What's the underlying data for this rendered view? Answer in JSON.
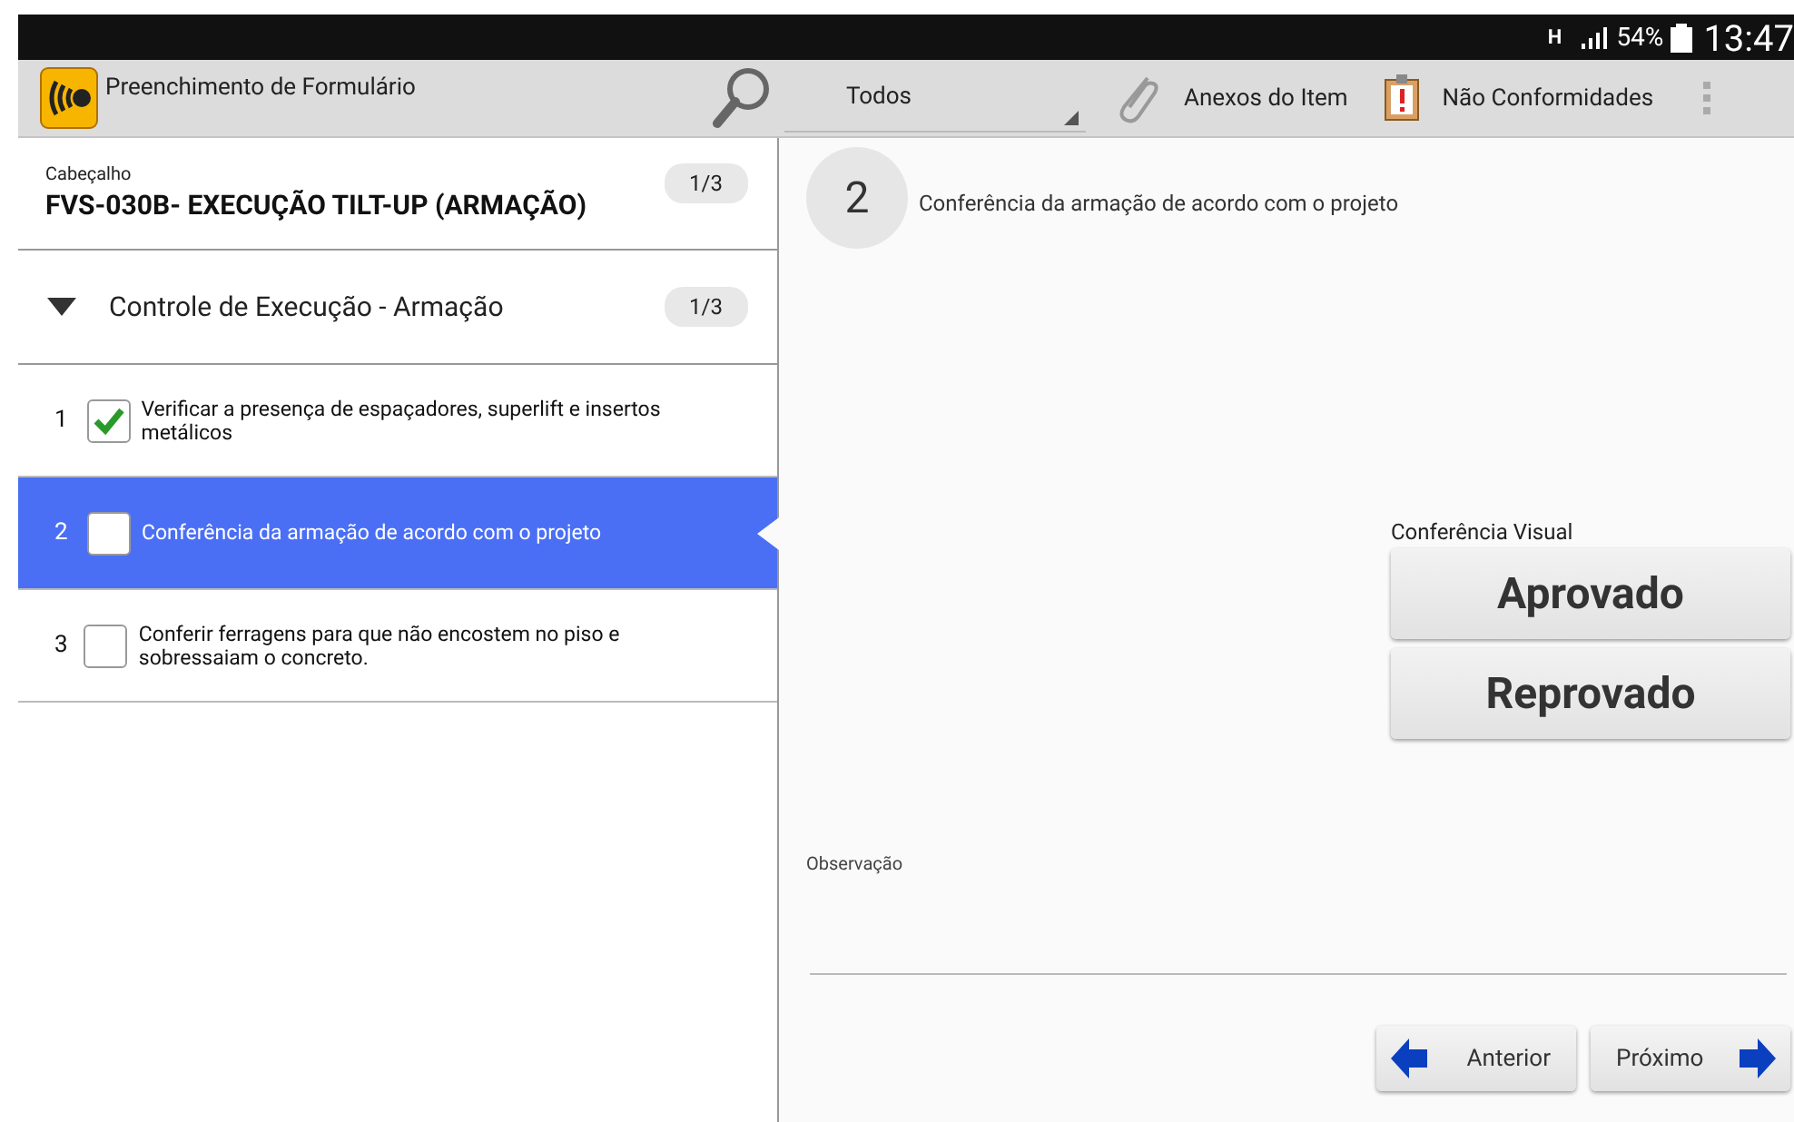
{
  "status_bar": {
    "network": "H",
    "battery": "54%",
    "time": "13:47"
  },
  "action_bar": {
    "title": "Preenchimento de Formulário",
    "filter": "Todos",
    "attachments": "Anexos do Item",
    "nonconformities": "Não Conformidades"
  },
  "header": {
    "label": "Cabeçalho",
    "title": "FVS-030B- EXECUÇÃO TILT-UP (ARMAÇÃO)",
    "count": "1/3"
  },
  "group": {
    "title": "Controle de Execução - Armação",
    "count": "1/3",
    "expanded": true
  },
  "items": [
    {
      "number": "1",
      "text": "Verificar a presença de espaçadores, superlift e insertos metálicos",
      "checked": true,
      "selected": false
    },
    {
      "number": "2",
      "text": "Conferência da armação de acordo com o projeto",
      "checked": false,
      "selected": true
    },
    {
      "number": "3",
      "text": "Conferir ferragens para que não encostem no piso e sobressaiam o concreto.",
      "checked": false,
      "selected": false
    }
  ],
  "detail": {
    "number": "2",
    "text": "Conferência da armação de acordo com o projeto",
    "check_label": "Conferência Visual",
    "options": [
      "Aprovado",
      "Reprovado"
    ],
    "observation_label": "Observação",
    "previous": "Anterior",
    "next": "Próximo"
  }
}
